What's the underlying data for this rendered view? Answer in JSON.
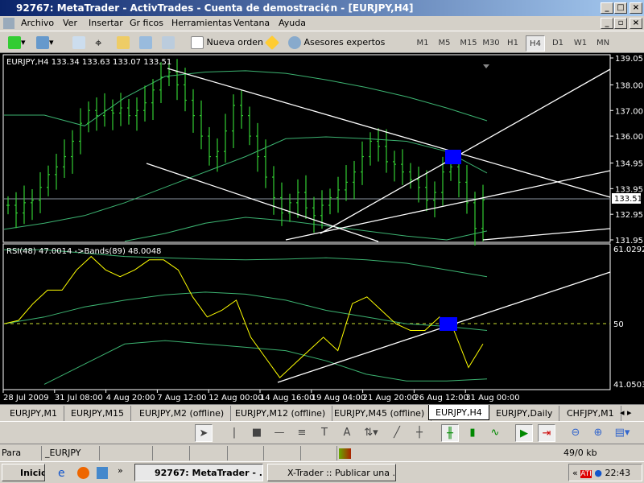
{
  "window": {
    "title": "92767: MetaTrader - ActivTrades - Cuenta de demostraci¢n - [EURJPY,H4]"
  },
  "menu": [
    "Archivo",
    "Ver",
    "Insertar",
    "Gr ficos",
    "Herramientas",
    "Ventana",
    "Ayuda"
  ],
  "toolbar": {
    "new_order": "Nueva orden",
    "experts": "Asesores expertos",
    "timeframes": [
      "M1",
      "M5",
      "M15",
      "M30",
      "H1",
      "H4",
      "D1",
      "W1",
      "MN"
    ],
    "active_timeframe": "H4"
  },
  "chart": {
    "header": "EURJPY,H4  133.34 133.63 133.07 133.51",
    "rsi_header": "RSI(48) 47.0014  ->Bands(89) 48.0048",
    "current_price": "133.51",
    "bar_color": "#32cd32",
    "band_color": "#3cb371",
    "rsi_color": "#ffff00",
    "marker_color": "#0000ff"
  },
  "chart_data": {
    "type": "ohlc",
    "price_ticks": [
      "139.05",
      "138.00",
      "137.00",
      "136.00",
      "134.95",
      "133.95",
      "132.95",
      "131.95"
    ],
    "rsi_ticks": [
      "61.0292",
      "50",
      "41.0503"
    ],
    "date_ticks": [
      "28 Jul 2009",
      "31 Jul 08:00",
      "4 Aug 20:00",
      "7 Aug 12:00",
      "12 Aug 00:00",
      "14 Aug 16:00",
      "19 Aug 04:00",
      "21 Aug 20:00",
      "26 Aug 12:00",
      "31 Aug 00:00"
    ],
    "ylim": [
      131.95,
      139.05
    ],
    "rsi_ylim": [
      41.0503,
      61.0292
    ],
    "closes": [
      133.3,
      133.0,
      133.4,
      133.5,
      134.0,
      134.5,
      134.8,
      135.2,
      135.8,
      136.5,
      137.0,
      136.8,
      137.0,
      136.9,
      137.1,
      136.8,
      137.0,
      137.3,
      137.8,
      138.3,
      138.5,
      138.0,
      137.4,
      136.8,
      136.0,
      135.2,
      135.4,
      136.2,
      137.2,
      136.8,
      136.0,
      135.2,
      134.4,
      133.6,
      133.0,
      133.4,
      133.8,
      133.2,
      132.9,
      133.3,
      133.6,
      133.9,
      134.2,
      134.6,
      135.2,
      135.8,
      135.6,
      135.0,
      134.9,
      134.6,
      134.3,
      134.0,
      133.5,
      133.8,
      134.6,
      134.8,
      134.2,
      133.4,
      132.4,
      133.51
    ],
    "bands_upper": [
      136.82,
      136.82,
      136.4,
      137.5,
      138.33,
      138.5,
      138.55,
      138.45,
      138.2,
      137.9,
      137.54,
      137.1,
      136.6
    ],
    "bands_middle": [
      132.36,
      132.6,
      132.9,
      133.4,
      134.0,
      134.6,
      135.2,
      135.9,
      135.97,
      135.9,
      135.8,
      135.4,
      134.56
    ],
    "bands_lower": [
      null,
      null,
      null,
      131.9,
      132.2,
      132.6,
      132.83,
      132.7,
      132.5,
      132.3,
      132.1,
      131.95,
      132.3
    ],
    "rsi": [
      50,
      50.5,
      53,
      55,
      55,
      58,
      60,
      58,
      57,
      58,
      59.5,
      59.5,
      58,
      54,
      51,
      52,
      53.5,
      48,
      45,
      42,
      44,
      46,
      48,
      46,
      53,
      54,
      52,
      50,
      49,
      49,
      51,
      49,
      43.5,
      47
    ],
    "rsi_upper": [
      61,
      61,
      60.5,
      60,
      59.8,
      59.6,
      59.5,
      59.6,
      59.8,
      59.5,
      59,
      58,
      57
    ],
    "rsi_middle": [
      50,
      51,
      52.5,
      53.5,
      54.3,
      54.7,
      54.4,
      53.5,
      52,
      51,
      50,
      49.6,
      49
    ],
    "rsi_lower": [
      null,
      41,
      44,
      47,
      47.5,
      47,
      46.5,
      46,
      44.5,
      42.5,
      41.5,
      41.5,
      41.8
    ]
  },
  "tabs": [
    "EURJPY,M1",
    "EURJPY,M15",
    "EURJPY,M2 (offline)",
    "EURJPY,M12 (offline)",
    "EURJPY,M45 (offline)",
    "EURJPY,H4",
    "EURJPY,Daily",
    "CHFJPY,M1"
  ],
  "statusbar": {
    "help": "Para obtener ay",
    "profile": "_EURJPY",
    "traffic": "49/0 kb"
  },
  "taskbar": {
    "start": "Inicio",
    "tasks": [
      "92767: MetaTrader - ...",
      "X-Trader :: Publicar una ..."
    ],
    "clock": "22:43"
  }
}
